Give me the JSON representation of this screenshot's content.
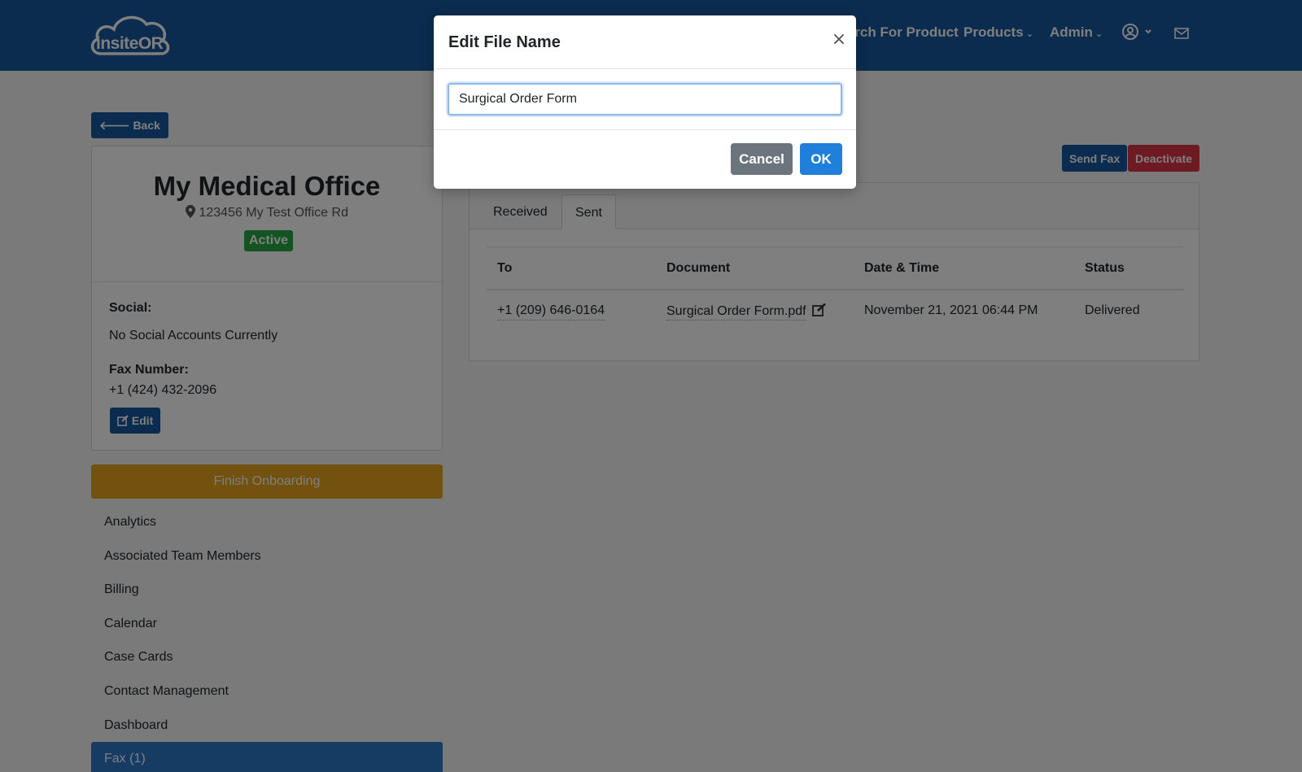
{
  "brand": {
    "logo_text": "insiteOR"
  },
  "nav": {
    "search_product": "Search For Product",
    "products": "Products",
    "admin": "Admin"
  },
  "page": {
    "back_label": "Back",
    "office_name": "My Medical Office",
    "address": "123456 My Test Office Rd",
    "status_badge": "Active",
    "social_label": "Social:",
    "social_value": "No Social Accounts Currently",
    "fax_label": "Fax Number:",
    "fax_value": "+1 (424) 432-2096",
    "edit_label": "Edit",
    "onboarding_label": "Finish Onboarding",
    "send_fax_label": "Send Fax",
    "deactivate_label": "Deactivate"
  },
  "sidebar": {
    "items": [
      {
        "label": "Analytics"
      },
      {
        "label": "Associated Team Members"
      },
      {
        "label": "Billing"
      },
      {
        "label": "Calendar"
      },
      {
        "label": "Case Cards"
      },
      {
        "label": "Contact Management"
      },
      {
        "label": "Dashboard"
      },
      {
        "label": "Fax (1)"
      }
    ]
  },
  "fax": {
    "tabs": [
      {
        "label": "Received"
      },
      {
        "label": "Sent"
      }
    ],
    "columns": [
      "To",
      "Document",
      "Date & Time",
      "Status"
    ],
    "rows": [
      {
        "to": "+1 (209) 646-0164",
        "document": "Surgical Order Form.pdf",
        "datetime": "November 21, 2021 06:44 PM",
        "status": "Delivered"
      }
    ]
  },
  "modal": {
    "title": "Edit File Name",
    "input_value": "Surgical Order Form",
    "cancel_label": "Cancel",
    "ok_label": "OK",
    "close_glyph": "×"
  },
  "colors": {
    "nav_blue": "#16599f",
    "active_green": "#28a745",
    "onboarding_gold": "#e6a31e",
    "deactivate_red": "#dc3545",
    "ok_blue": "#1f7fdb"
  }
}
